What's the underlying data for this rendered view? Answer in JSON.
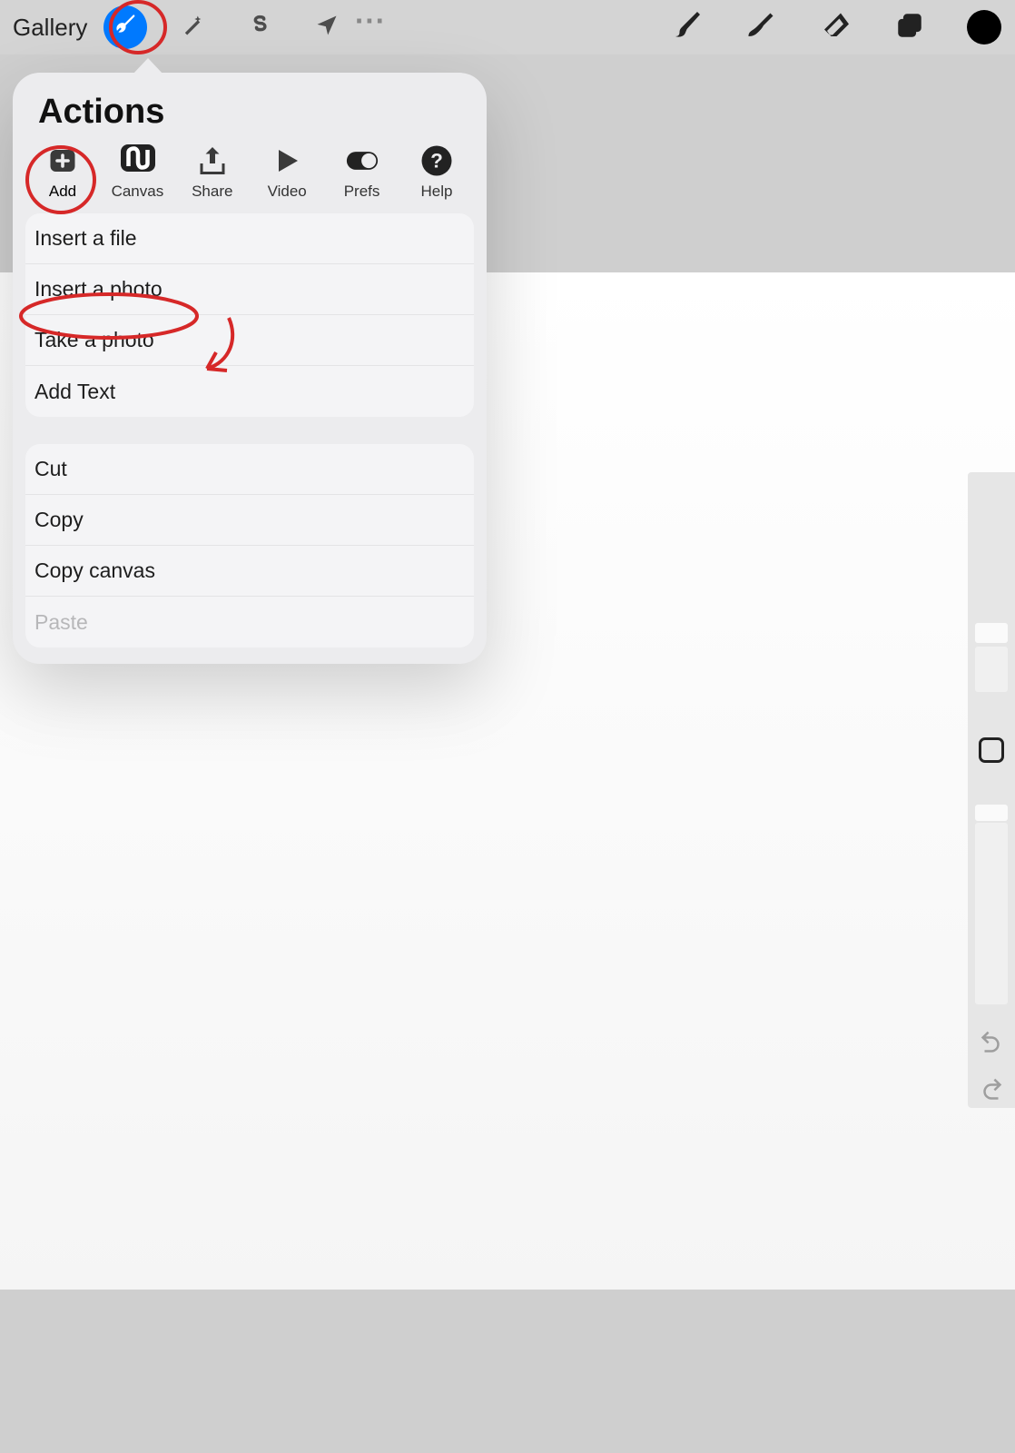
{
  "toolbar": {
    "gallery": "Gallery"
  },
  "popover": {
    "title": "Actions",
    "tabs": [
      {
        "label": "Add"
      },
      {
        "label": "Canvas"
      },
      {
        "label": "Share"
      },
      {
        "label": "Video"
      },
      {
        "label": "Prefs"
      },
      {
        "label": "Help"
      }
    ],
    "group1": [
      "Insert a file",
      "Insert a photo",
      "Take a photo",
      "Add Text"
    ],
    "group2": [
      {
        "label": "Cut",
        "disabled": false
      },
      {
        "label": "Copy",
        "disabled": false
      },
      {
        "label": "Copy canvas",
        "disabled": false
      },
      {
        "label": "Paste",
        "disabled": true
      }
    ]
  }
}
